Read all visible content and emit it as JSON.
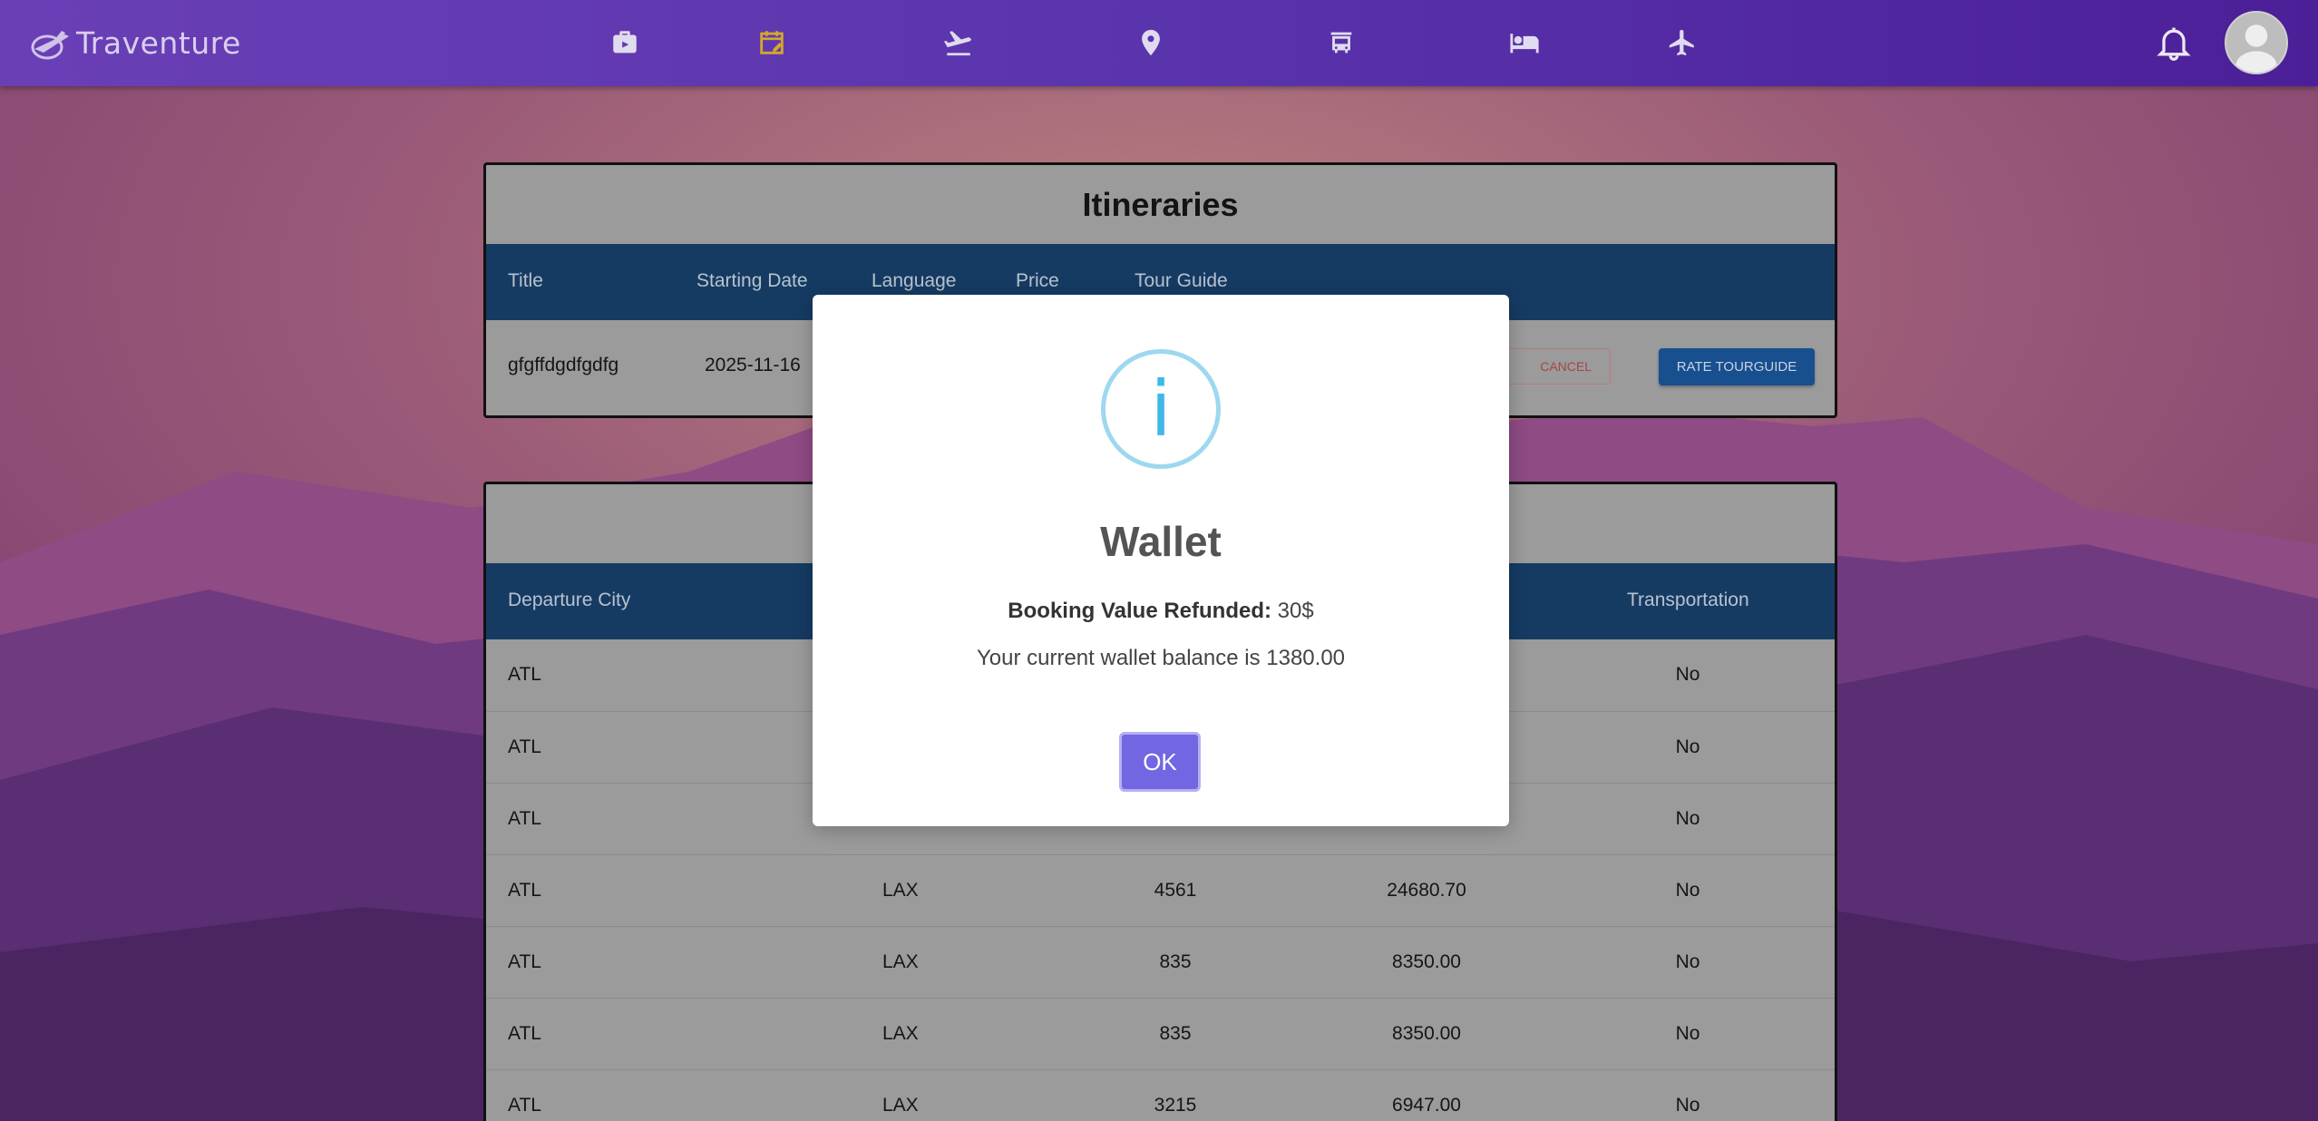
{
  "navbar": {
    "brand": "Traventure",
    "icons": [
      "briefcase-icon",
      "calendar-edit-icon",
      "flight-takeoff-icon",
      "location-pin-icon",
      "bus-icon",
      "bed-icon",
      "airplane-icon"
    ],
    "active_icon": "calendar-edit-icon",
    "accent_active": "#d4a72c"
  },
  "itineraries": {
    "title": "Itineraries",
    "columns": [
      "Title",
      "Starting Date",
      "Language",
      "Price",
      "Tour Guide"
    ],
    "rows": [
      {
        "title": "gfgffdgdfgdfg",
        "starting_date": "2025-11-16"
      }
    ],
    "cancel_label": "CANCEL",
    "rate_label": "RATE TOURGUIDE"
  },
  "flights": {
    "columns": {
      "departure_city": "Departure City",
      "transportation": "Transportation"
    },
    "rows": [
      {
        "departure": "ATL",
        "arrival": "",
        "number": "",
        "price": "",
        "transport": "No"
      },
      {
        "departure": "ATL",
        "arrival": "",
        "number": "",
        "price": "",
        "transport": "No"
      },
      {
        "departure": "ATL",
        "arrival": "",
        "number": "",
        "price": "",
        "transport": "No"
      },
      {
        "departure": "ATL",
        "arrival": "LAX",
        "number": "4561",
        "price": "24680.70",
        "transport": "No"
      },
      {
        "departure": "ATL",
        "arrival": "LAX",
        "number": "835",
        "price": "8350.00",
        "transport": "No"
      },
      {
        "departure": "ATL",
        "arrival": "LAX",
        "number": "835",
        "price": "8350.00",
        "transport": "No"
      },
      {
        "departure": "ATL",
        "arrival": "LAX",
        "number": "3215",
        "price": "6947.00",
        "transport": "No"
      }
    ]
  },
  "modal": {
    "icon": "info-icon",
    "icon_glyph": "i",
    "title": "Wallet",
    "refund_label": "Booking Value Refunded:",
    "refund_value": "30$",
    "balance_text": "Your current wallet balance is 1380.00",
    "ok_label": "OK"
  }
}
